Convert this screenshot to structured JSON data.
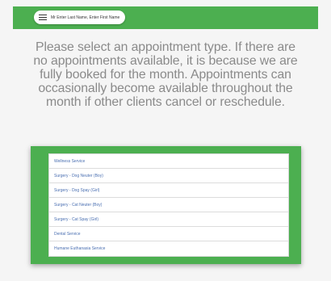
{
  "header": {
    "user_name": "Mr Enter Last Name, Enter First Name",
    "color": "#4caf50"
  },
  "instructions": {
    "text": "Please select an appointment type. If there are no appointments available, it is because we are fully booked for the month. Appointments can occasionally become available throughout the month if other clients cancel or reschedule."
  },
  "appointment_types": [
    {
      "label": "Wellness Service"
    },
    {
      "label": "Surgery - Dog Neuter (Boy)"
    },
    {
      "label": "Surgery - Dog Spay (Girl)"
    },
    {
      "label": "Surgery - Cat Neuter (Boy)"
    },
    {
      "label": "Surgery - Cat Spay (Girl)"
    },
    {
      "label": "Dental Service"
    },
    {
      "label": "Humane Euthanasia Service"
    }
  ]
}
